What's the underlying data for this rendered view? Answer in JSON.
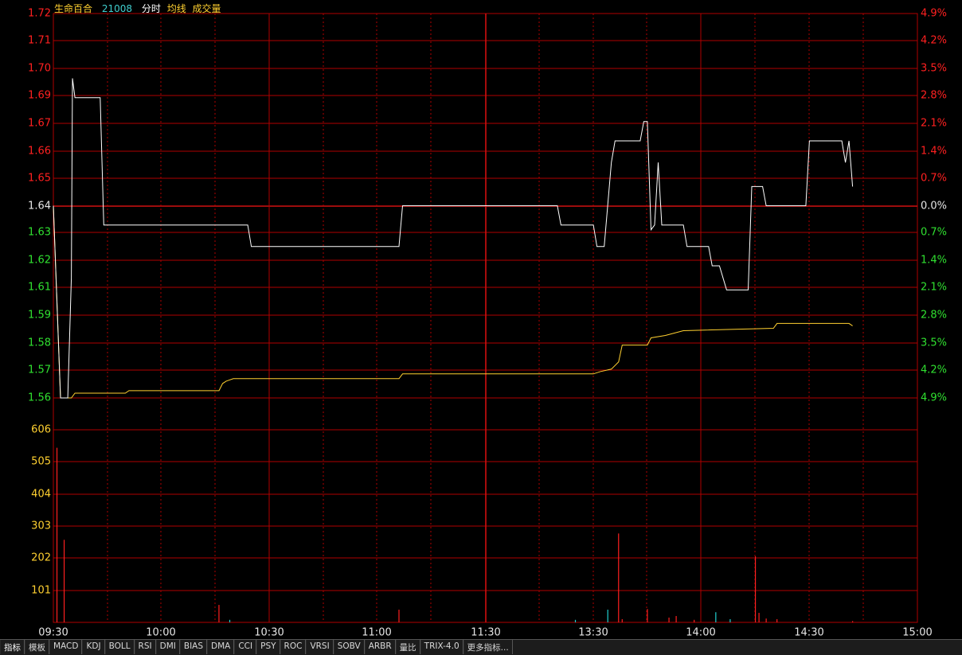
{
  "header": {
    "stock_name": "生命百合",
    "stock_code": "21008",
    "mode_label": "分时",
    "avg_label": "均线",
    "volume_label": "成交量"
  },
  "colors": {
    "grid": "#b00000",
    "grid_major": "#d01010",
    "up": "#ff2020",
    "down": "#30e030",
    "price_line": "#ffffff",
    "avg_line": "#ffd030",
    "volume_axis": "#ffd030",
    "time_axis": "#e6e6e6",
    "volume_bar": "#ff2020",
    "volume_bar_alt": "#20d0d0"
  },
  "price_axis": {
    "labels": [
      "1.72",
      "1.71",
      "1.70",
      "1.69",
      "1.67",
      "1.66",
      "1.65",
      "1.64",
      "1.63",
      "1.62",
      "1.61",
      "1.59",
      "1.58",
      "1.57",
      "1.56"
    ],
    "colors": [
      "up",
      "up",
      "up",
      "up",
      "up",
      "up",
      "up",
      "neutral",
      "down",
      "down",
      "down",
      "down",
      "down",
      "down",
      "down"
    ]
  },
  "percent_axis": {
    "labels": [
      "4.9%",
      "4.2%",
      "3.5%",
      "2.8%",
      "2.1%",
      "1.4%",
      "0.7%",
      "0.0%",
      "0.7%",
      "1.4%",
      "2.1%",
      "2.8%",
      "3.5%",
      "4.2%",
      "4.9%"
    ]
  },
  "volume_axis": {
    "labels": [
      "606",
      "505",
      "404",
      "303",
      "202",
      "101"
    ]
  },
  "time_axis": {
    "labels": [
      "09:30",
      "10:00",
      "10:30",
      "11:00",
      "11:30",
      "13:30",
      "14:00",
      "14:30",
      "15:00"
    ]
  },
  "chart_data": {
    "type": "line",
    "title": "",
    "reference_price": 1.64,
    "price_range": [
      1.56,
      1.72
    ],
    "volume_range": [
      0,
      707
    ],
    "x": [
      "09:30",
      "10:00",
      "10:30",
      "11:00",
      "11:30",
      "13:30",
      "14:00",
      "14:30",
      "15:00"
    ],
    "price_series": [
      [
        0,
        1.64
      ],
      [
        2,
        1.56
      ],
      [
        4,
        1.56
      ],
      [
        5,
        1.61
      ],
      [
        5.3,
        1.693
      ],
      [
        6,
        1.685
      ],
      [
        8,
        1.685
      ],
      [
        13,
        1.685
      ],
      [
        14,
        1.632
      ],
      [
        30,
        1.632
      ],
      [
        54,
        1.632
      ],
      [
        55,
        1.623
      ],
      [
        75,
        1.623
      ],
      [
        96,
        1.623
      ],
      [
        97,
        1.64
      ],
      [
        120,
        1.64
      ],
      [
        140,
        1.64
      ],
      [
        141,
        1.632
      ],
      [
        150,
        1.632
      ],
      [
        151,
        1.623
      ],
      [
        153,
        1.623
      ],
      [
        155,
        1.658
      ],
      [
        156,
        1.667
      ],
      [
        163,
        1.667
      ],
      [
        164,
        1.675
      ],
      [
        165,
        1.675
      ],
      [
        166,
        1.63
      ],
      [
        167,
        1.632
      ],
      [
        168,
        1.658
      ],
      [
        169,
        1.632
      ],
      [
        175,
        1.632
      ],
      [
        176,
        1.623
      ],
      [
        182,
        1.623
      ],
      [
        183,
        1.615
      ],
      [
        185,
        1.615
      ],
      [
        187,
        1.605
      ],
      [
        193,
        1.605
      ],
      [
        194,
        1.648
      ],
      [
        197,
        1.648
      ],
      [
        198,
        1.64
      ],
      [
        209,
        1.64
      ],
      [
        210,
        1.667
      ],
      [
        219,
        1.667
      ],
      [
        220,
        1.658
      ],
      [
        221,
        1.667
      ],
      [
        222,
        1.648
      ]
    ],
    "avg_series": [
      [
        0,
        1.64
      ],
      [
        2,
        1.56
      ],
      [
        5,
        1.56
      ],
      [
        6,
        1.562
      ],
      [
        20,
        1.562
      ],
      [
        21,
        1.563
      ],
      [
        46,
        1.563
      ],
      [
        47,
        1.566
      ],
      [
        48,
        1.567
      ],
      [
        50,
        1.568
      ],
      [
        96,
        1.568
      ],
      [
        97,
        1.57
      ],
      [
        150,
        1.57
      ],
      [
        152,
        1.571
      ],
      [
        155,
        1.572
      ],
      [
        157,
        1.575
      ],
      [
        158,
        1.582
      ],
      [
        165,
        1.582
      ],
      [
        166,
        1.585
      ],
      [
        170,
        1.586
      ],
      [
        175,
        1.588
      ],
      [
        200,
        1.589
      ],
      [
        201,
        1.591
      ],
      [
        210,
        1.591
      ],
      [
        221,
        1.591
      ],
      [
        222,
        1.59
      ]
    ],
    "volume_series": [
      {
        "t": 1,
        "v": 550,
        "c": "up"
      },
      {
        "t": 3,
        "v": 260,
        "c": "up"
      },
      {
        "t": 46,
        "v": 55,
        "c": "up"
      },
      {
        "t": 49,
        "v": 8,
        "c": "alt"
      },
      {
        "t": 96,
        "v": 40,
        "c": "up"
      },
      {
        "t": 145,
        "v": 8,
        "c": "alt"
      },
      {
        "t": 154,
        "v": 40,
        "c": "alt"
      },
      {
        "t": 157,
        "v": 280,
        "c": "up"
      },
      {
        "t": 158,
        "v": 10,
        "c": "up"
      },
      {
        "t": 165,
        "v": 42,
        "c": "up"
      },
      {
        "t": 171,
        "v": 15,
        "c": "up"
      },
      {
        "t": 173,
        "v": 20,
        "c": "up"
      },
      {
        "t": 178,
        "v": 8,
        "c": "up"
      },
      {
        "t": 184,
        "v": 32,
        "c": "alt"
      },
      {
        "t": 188,
        "v": 10,
        "c": "alt"
      },
      {
        "t": 195,
        "v": 208,
        "c": "up"
      },
      {
        "t": 196,
        "v": 30,
        "c": "up"
      },
      {
        "t": 198,
        "v": 12,
        "c": "up"
      },
      {
        "t": 201,
        "v": 10,
        "c": "up"
      },
      {
        "t": 222,
        "v": 4,
        "c": "up"
      }
    ]
  },
  "tabs": [
    "指标",
    "模板",
    "MACD",
    "KDJ",
    "BOLL",
    "RSI",
    "DMI",
    "BIAS",
    "DMA",
    "CCI",
    "PSY",
    "ROC",
    "VRSI",
    "SOBV",
    "ARBR",
    "量比",
    "TRIX-4.0",
    "更多指标..."
  ]
}
